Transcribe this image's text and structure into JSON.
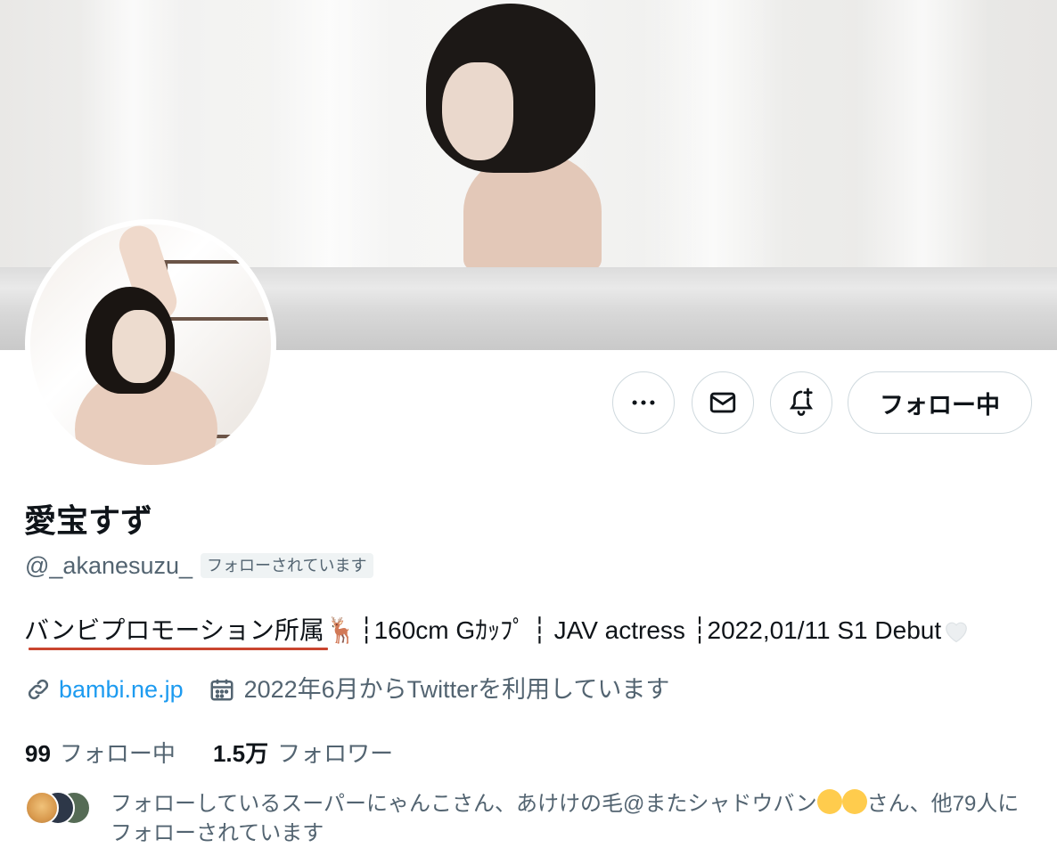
{
  "profile": {
    "display_name": "愛宝すず",
    "handle": "@_akanesuzu_",
    "follows_you_badge": "フォローされています",
    "bio": {
      "org": "バンビプロモーション所属",
      "org_emoji": "🦌",
      "rest": "┆160cm Gｶｯﾌﾟ ┆ JAV actress ┆2022,01/11 S1 Debut",
      "heart_emoji": "white-heart"
    },
    "website": "bambi.ne.jp",
    "joined": "2022年6月からTwitterを利用しています",
    "following_count": "99",
    "following_label": "フォロー中",
    "followers_count": "1.5万",
    "followers_label": "フォロワー",
    "followed_by_prefix": "フォローしているスーパーにゃんこさん、あけけの毛@またシャドウバン",
    "followed_by_suffix": "さん、他79人にフォローされています"
  },
  "actions": {
    "more_icon": "more-horizontal-icon",
    "message_icon": "mail-icon",
    "notify_icon": "bell-plus-icon",
    "follow_label": "フォロー中"
  },
  "colors": {
    "link": "#1d9bf0",
    "secondary_text": "#536471",
    "underline_annotation": "#c9452f"
  }
}
